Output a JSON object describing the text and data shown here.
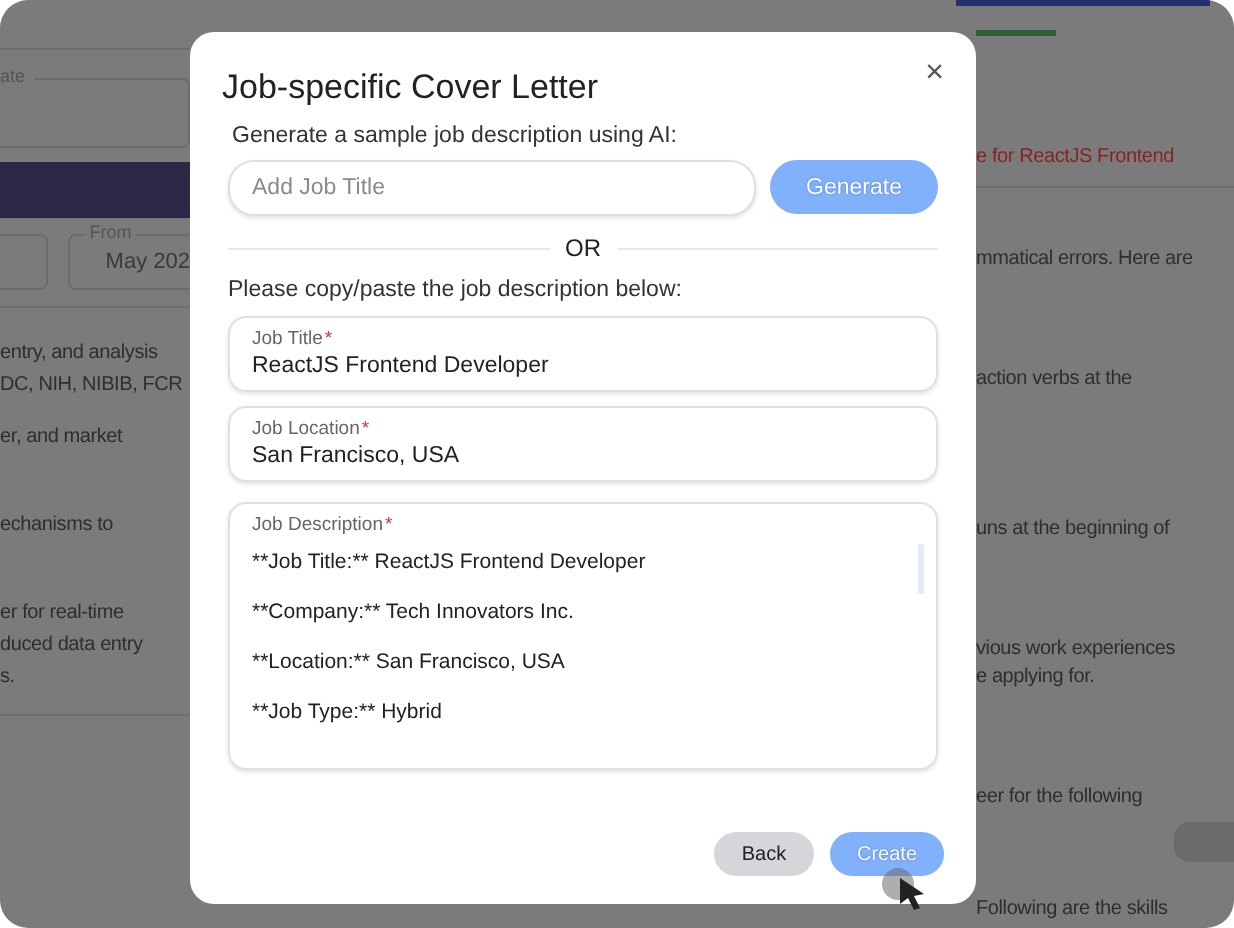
{
  "background": {
    "left_panel": {
      "field_label": "ate",
      "from_label": "From",
      "from_value": "May 202",
      "text_lines": [
        "entry, and analysis",
        "DC, NIH, NIBIB, FCR",
        "er, and market",
        "echanisms to",
        "er for real-time",
        "duced data entry",
        "s."
      ]
    },
    "right_panel": {
      "warning": "e for ReactJS Frontend",
      "text_lines": [
        "mmatical errors. Here are",
        "action verbs at the",
        "uns at the beginning of",
        "vious work experiences",
        "e applying for.",
        "eer for the following"
      ],
      "footer_text": "Following are the skills"
    }
  },
  "dialog": {
    "title": "Job-specific Cover Letter",
    "close": "×",
    "generate_prompt": "Generate a sample job description using AI:",
    "job_title_input": {
      "placeholder": "Add Job Title"
    },
    "generate_button": {
      "label": "Generate",
      "disabled": true
    },
    "divider": "OR",
    "paste_prompt": "Please copy/paste the job description below:",
    "fields": [
      {
        "label": "Job Title",
        "marker": "*",
        "value": "ReactJS Frontend Developer"
      },
      {
        "label": "Job Location",
        "marker": "*",
        "value": "San Francisco, USA"
      }
    ],
    "description": {
      "label": "Job Description",
      "marker": "*",
      "lines": [
        "**Job Title:** ReactJS Frontend Developer",
        "**Company:** Tech Innovators Inc.",
        "**Location:** San Francisco, USA",
        "**Job Type:** Hybrid"
      ]
    },
    "buttons": [
      {
        "label": "Back",
        "kind": "secondary"
      },
      {
        "label": "Create",
        "kind": "primary",
        "disabled": true
      }
    ]
  }
}
